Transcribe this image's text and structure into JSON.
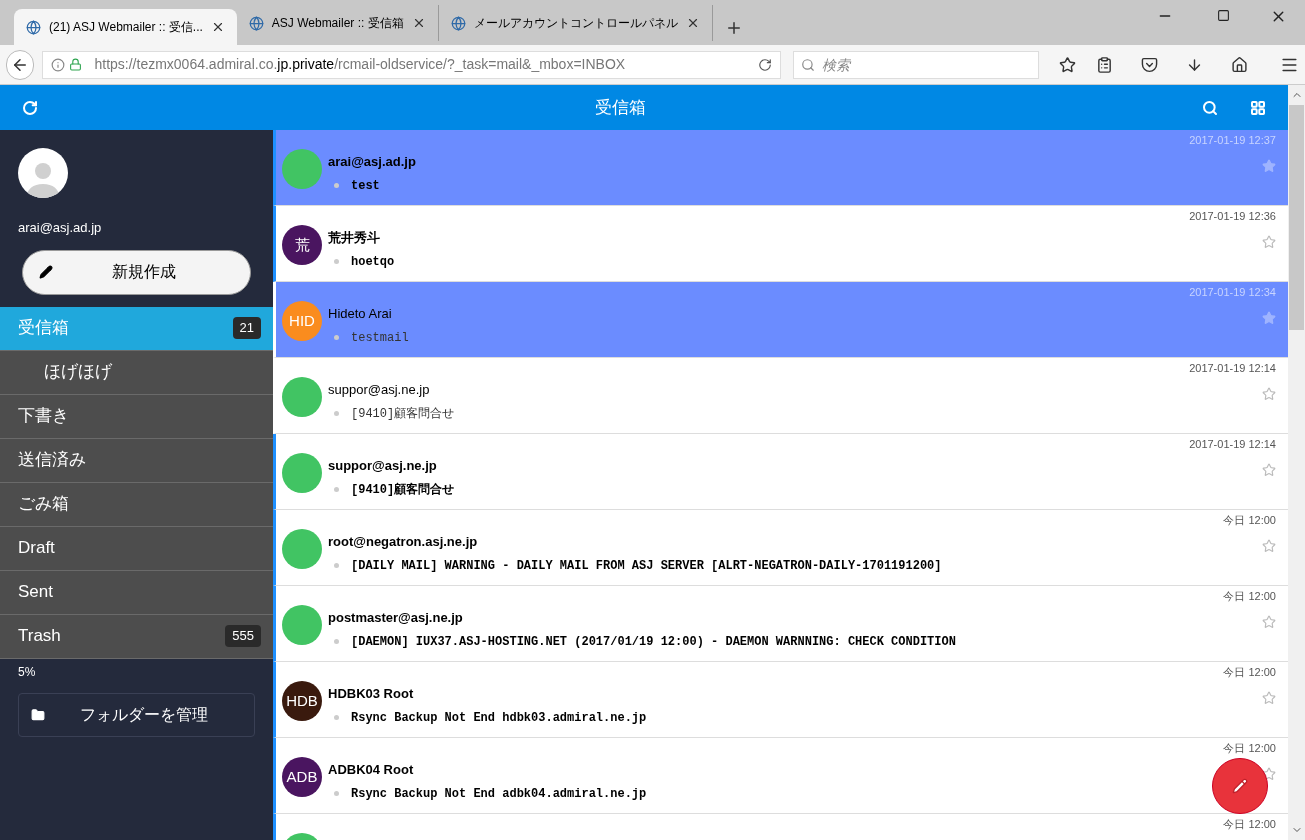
{
  "browser": {
    "tabs": [
      {
        "title": "(21) ASJ Webmailer :: 受信...",
        "selected": true
      },
      {
        "title": "ASJ Webmailer :: 受信箱",
        "selected": false
      },
      {
        "title": "メールアカウントコントロールパネル",
        "selected": false
      }
    ],
    "url": {
      "host_prefix": "https://tezmx0064.admiral.co.",
      "host_domain": "jp.private",
      "path": "/rcmail-oldservice/?_task=mail&_mbox=INBOX"
    },
    "search": {
      "placeholder": "検索"
    }
  },
  "header": {
    "title": "受信箱"
  },
  "sidebar": {
    "email": "arai@asj.ad.jp",
    "compose_button": "新規作成",
    "folders": [
      {
        "name": "受信箱",
        "selected": true,
        "badge": "21",
        "children": [
          {
            "name": "ほげほげ",
            "selected": false
          }
        ]
      },
      {
        "name": "下書き",
        "selected": false
      },
      {
        "name": "送信済み",
        "selected": false
      },
      {
        "name": "ごみ箱",
        "selected": false
      },
      {
        "name": "Draft",
        "selected": false
      },
      {
        "name": "Sent",
        "selected": false
      },
      {
        "name": "Trash",
        "selected": false,
        "badge": "555"
      }
    ],
    "quota": "5%",
    "manage_button": "フォルダーを管理"
  },
  "messages": [
    {
      "sender": "arai@asj.ad.jp",
      "subject": "test",
      "time": "2017-01-19 12:37",
      "selected": true,
      "unread": true,
      "color": "#41c463"
    },
    {
      "sender": "荒井秀斗",
      "subject": "hoetqo",
      "time": "2017-01-19 12:36",
      "selected": false,
      "unread": true,
      "color": "#4a1560",
      "initials": "荒"
    },
    {
      "sender": "Hideto Arai",
      "subject": "testmail",
      "time": "2017-01-19 12:34",
      "selected": true,
      "unread": false,
      "color": "#fa8c1e",
      "initials": "HID"
    },
    {
      "sender": "suppor@asj.ne.jp",
      "subject": "[9410]顧客問合せ",
      "time": "2017-01-19 12:14",
      "selected": false,
      "unread": false,
      "color": "#41c463"
    },
    {
      "sender": "suppor@asj.ne.jp",
      "subject": "[9410]顧客問合せ",
      "time": "2017-01-19 12:14",
      "selected": false,
      "unread": true,
      "color": "#41c463"
    },
    {
      "sender": "root@negatron.asj.ne.jp",
      "subject": "[DAILY MAIL] WARNING - DAILY MAIL FROM ASJ SERVER [ALRT-NEGATRON-DAILY-1701191200]",
      "time": "今日 12:00",
      "selected": false,
      "unread": true,
      "color": "#41c463"
    },
    {
      "sender": "postmaster@asj.ne.jp",
      "subject": "[DAEMON] IUX37.ASJ-HOSTING.NET (2017/01/19 12:00) - DAEMON WARNNING: CHECK CONDITION",
      "time": "今日 12:00",
      "selected": false,
      "unread": true,
      "color": "#41c463"
    },
    {
      "sender": "HDBK03 Root",
      "subject": "Rsync Backup Not End hdbk03.admiral.ne.jp",
      "time": "今日 12:00",
      "selected": false,
      "unread": true,
      "color": "#3a1a0e",
      "initials": "HDB"
    },
    {
      "sender": "ADBK04 Root",
      "subject": "Rsync Backup Not End adbk04.admiral.ne.jp",
      "time": "今日 12:00",
      "selected": false,
      "unread": true,
      "color": "#4a1560",
      "initials": "ADB"
    },
    {
      "time": "今日 12:00",
      "selected": false,
      "unread": true,
      "color": "#41c463"
    }
  ]
}
